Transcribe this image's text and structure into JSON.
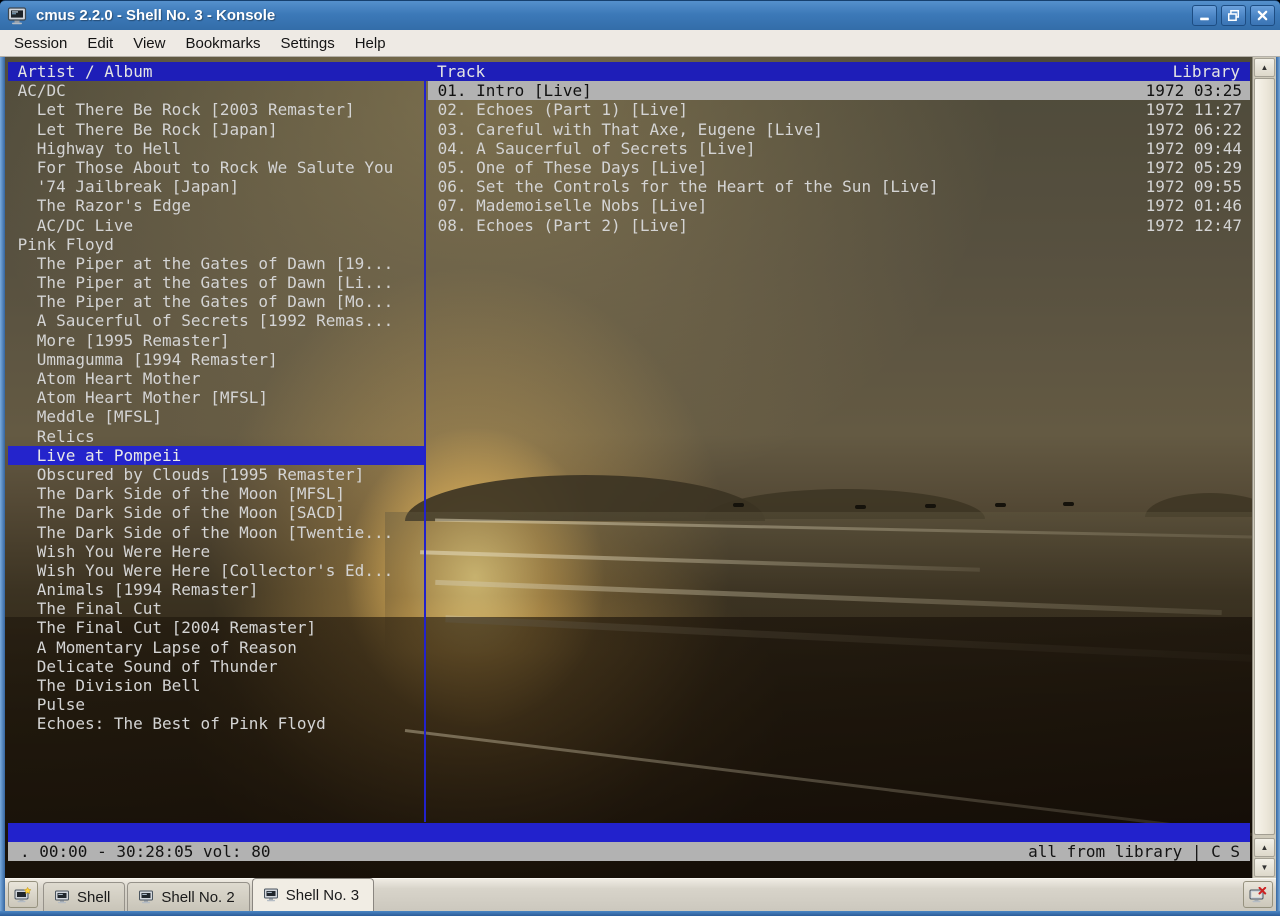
{
  "window": {
    "title": "cmus 2.2.0 - Shell No. 3 - Konsole"
  },
  "menu": {
    "items": [
      "Session",
      "Edit",
      "View",
      "Bookmarks",
      "Settings",
      "Help"
    ]
  },
  "cmus": {
    "left_pane": {
      "header": "Artist / Album",
      "items": [
        {
          "label": "AC/DC",
          "indent": "artist"
        },
        {
          "label": "Let There Be Rock [2003 Remaster]",
          "indent": "album"
        },
        {
          "label": "Let There Be Rock [Japan]",
          "indent": "album"
        },
        {
          "label": "Highway to Hell",
          "indent": "album"
        },
        {
          "label": "For Those About to Rock We Salute You",
          "indent": "album"
        },
        {
          "label": "'74 Jailbreak [Japan]",
          "indent": "album"
        },
        {
          "label": "The Razor's Edge",
          "indent": "album"
        },
        {
          "label": "AC/DC Live",
          "indent": "album"
        },
        {
          "label": "Pink Floyd",
          "indent": "artist"
        },
        {
          "label": "The Piper at the Gates of Dawn [19...",
          "indent": "album"
        },
        {
          "label": "The Piper at the Gates of Dawn [Li...",
          "indent": "album"
        },
        {
          "label": "The Piper at the Gates of Dawn [Mo...",
          "indent": "album"
        },
        {
          "label": "A Saucerful of Secrets [1992 Remas...",
          "indent": "album"
        },
        {
          "label": "More [1995 Remaster]",
          "indent": "album"
        },
        {
          "label": "Ummagumma [1994 Remaster]",
          "indent": "album"
        },
        {
          "label": "Atom Heart Mother",
          "indent": "album"
        },
        {
          "label": "Atom Heart Mother [MFSL]",
          "indent": "album"
        },
        {
          "label": "Meddle [MFSL]",
          "indent": "album"
        },
        {
          "label": "Relics",
          "indent": "album"
        },
        {
          "label": "Live at Pompeii",
          "indent": "album",
          "selected": true
        },
        {
          "label": "Obscured by Clouds [1995 Remaster]",
          "indent": "album"
        },
        {
          "label": "The Dark Side of the Moon [MFSL]",
          "indent": "album"
        },
        {
          "label": "The Dark Side of the Moon [SACD]",
          "indent": "album"
        },
        {
          "label": "The Dark Side of the Moon [Twentie...",
          "indent": "album"
        },
        {
          "label": "Wish You Were Here",
          "indent": "album"
        },
        {
          "label": "Wish You Were Here [Collector's Ed...",
          "indent": "album"
        },
        {
          "label": "Animals [1994 Remaster]",
          "indent": "album"
        },
        {
          "label": "The Final Cut",
          "indent": "album"
        },
        {
          "label": "The Final Cut [2004 Remaster]",
          "indent": "album"
        },
        {
          "label": "A Momentary Lapse of Reason",
          "indent": "album"
        },
        {
          "label": "Delicate Sound of Thunder",
          "indent": "album"
        },
        {
          "label": "The Division Bell",
          "indent": "album"
        },
        {
          "label": "Pulse",
          "indent": "album"
        },
        {
          "label": "Echoes: The Best of Pink Floyd",
          "indent": "album"
        }
      ]
    },
    "right_pane": {
      "header": "Track",
      "header_right": "Library",
      "tracks": [
        {
          "title": "01. Intro [Live]",
          "year": "1972",
          "duration": "03:25",
          "highlighted": true
        },
        {
          "title": "02. Echoes (Part 1) [Live]",
          "year": "1972",
          "duration": "11:27"
        },
        {
          "title": "03. Careful with That Axe, Eugene [Live]",
          "year": "1972",
          "duration": "06:22"
        },
        {
          "title": "04. A Saucerful of Secrets [Live]",
          "year": "1972",
          "duration": "09:44"
        },
        {
          "title": "05. One of These Days [Live]",
          "year": "1972",
          "duration": "05:29"
        },
        {
          "title": "06. Set the Controls for the Heart of the Sun [Live]",
          "year": "1972",
          "duration": "09:55"
        },
        {
          "title": "07. Mademoiselle Nobs [Live]",
          "year": "1972",
          "duration": "01:46"
        },
        {
          "title": "08. Echoes (Part 2) [Live]",
          "year": "1972",
          "duration": "12:47"
        }
      ]
    },
    "status_line": {
      "left": ". 00:00 - 30:28:05 vol: 80",
      "right": "all from library | C S"
    }
  },
  "tabs": {
    "items": [
      {
        "label": "Shell"
      },
      {
        "label": "Shell No. 2"
      },
      {
        "label": "Shell No. 3",
        "active": true
      }
    ]
  },
  "icons": {
    "scroll_up_glyph": "▲",
    "scroll_down_glyph": "▼"
  },
  "colors": {
    "titlebar_blue": "#3c79b8",
    "window_border_blue": "#35659f",
    "cmus_header_blue": "#1e1eb8",
    "selection_blue": "#2424cc",
    "inactive_selection_gray": "#b2b2b2",
    "statusline_gray": "#b2b2b2",
    "terminal_text": "#d4d4d4"
  }
}
